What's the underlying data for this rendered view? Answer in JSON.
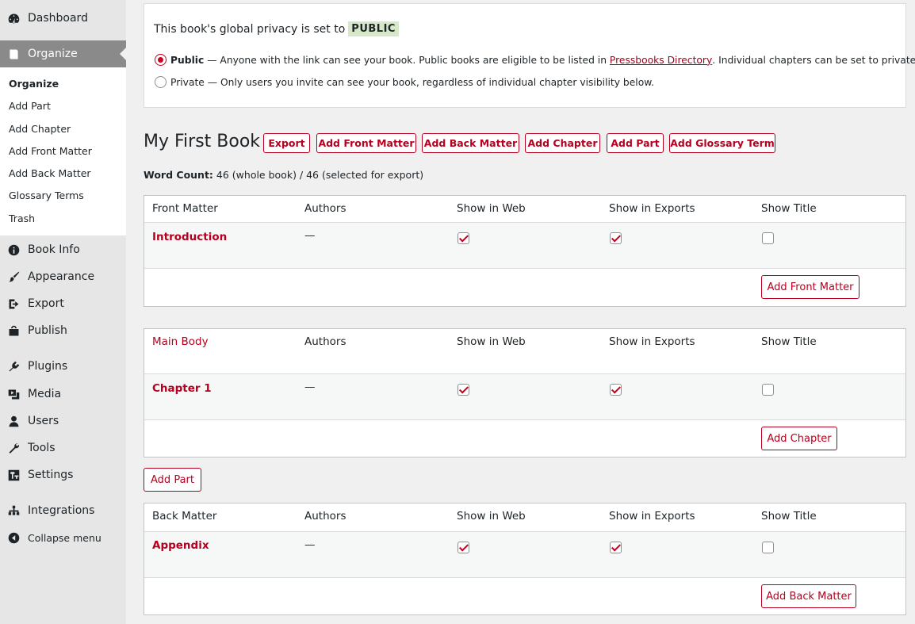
{
  "sidebar": {
    "dashboard": "Dashboard",
    "organize": "Organize",
    "submenu": [
      "Organize",
      "Add Part",
      "Add Chapter",
      "Add Front Matter",
      "Add Back Matter",
      "Glossary Terms",
      "Trash"
    ],
    "book_info": "Book Info",
    "appearance": "Appearance",
    "export": "Export",
    "publish": "Publish",
    "plugins": "Plugins",
    "media": "Media",
    "users": "Users",
    "tools": "Tools",
    "settings": "Settings",
    "integrations": "Integrations",
    "collapse": "Collapse menu"
  },
  "privacy": {
    "heading": "This book's global privacy is set to",
    "badge": "PUBLIC",
    "public_label": "Public",
    "public_desc_before": " — Anyone with the link can see your book. Public books are eligible to be listed in ",
    "public_link": "Pressbooks Directory",
    "public_desc_after": ". Individual chapters can be set to private.",
    "private_text": "Private — Only users you invite can see your book, regardless of individual chapter visibility below."
  },
  "book": {
    "title": "My First Book",
    "buttons": {
      "export": "Export",
      "add_front_matter": "Add Front Matter",
      "add_back_matter": "Add Back Matter",
      "add_chapter": "Add Chapter",
      "add_part": "Add Part",
      "add_glossary_term": "Add Glossary Term"
    },
    "word_count_label": "Word Count:",
    "word_count_value": " 46 (whole book) / 46 (selected for export)"
  },
  "columns": {
    "authors": "Authors",
    "show_in_web": "Show in Web",
    "show_in_exports": "Show in Exports",
    "show_title": "Show Title"
  },
  "front_matter": {
    "heading": "Front Matter",
    "row": {
      "title": "Introduction",
      "authors": "—",
      "web": true,
      "exports": true,
      "show_title": false
    },
    "add_button": "Add Front Matter"
  },
  "main_body": {
    "heading": "Main Body",
    "row": {
      "title": "Chapter 1",
      "authors": "—",
      "web": true,
      "exports": true,
      "show_title": false
    },
    "add_button": "Add Chapter"
  },
  "add_part_button": "Add Part",
  "back_matter": {
    "heading": "Back Matter",
    "row": {
      "title": "Appendix",
      "authors": "—",
      "web": true,
      "exports": true,
      "show_title": false
    },
    "add_button": "Add Back Matter"
  }
}
